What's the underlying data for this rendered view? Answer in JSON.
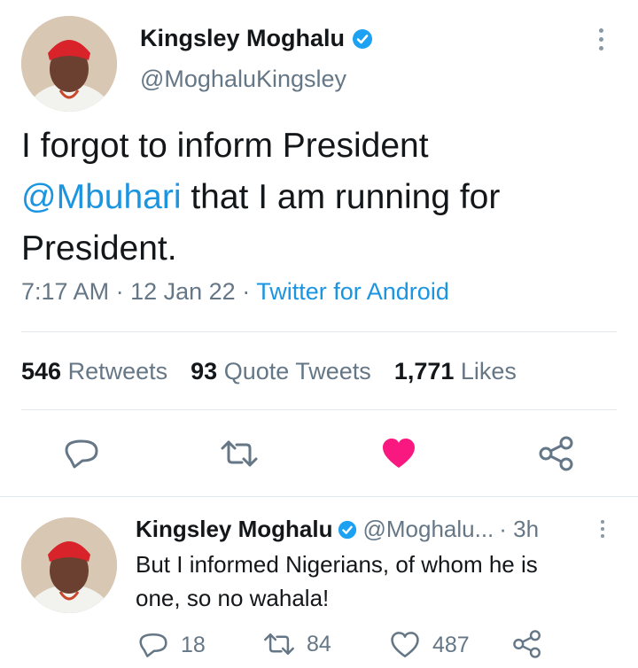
{
  "tweet": {
    "author_name": "Kingsley Moghalu",
    "author_handle": "@MoghaluKingsley",
    "text_part1": "I forgot to inform President",
    "mention": "@Mbuhari",
    "text_part2": " that I am running for",
    "text_part3": "President.",
    "time": "7:17 AM",
    "date": "12 Jan 22",
    "sep": "·",
    "source": "Twitter for Android",
    "stats": {
      "retweets_count": "546",
      "retweets_label": "Retweets",
      "quotes_count": "93",
      "quotes_label": "Quote Tweets",
      "likes_count": "1,771",
      "likes_label": "Likes"
    },
    "liked": true,
    "colors": {
      "like_active": "#f91880",
      "link": "#1b95e0",
      "verified": "#1da1f2"
    }
  },
  "reply": {
    "author_name": "Kingsley Moghalu",
    "author_handle": "@Moghalu...",
    "age": "· 3h",
    "line1": "But I informed Nigerians, of whom he is",
    "line2": "one, so no wahala!",
    "reply_count": "18",
    "retweet_count": "84",
    "like_count": "487"
  }
}
